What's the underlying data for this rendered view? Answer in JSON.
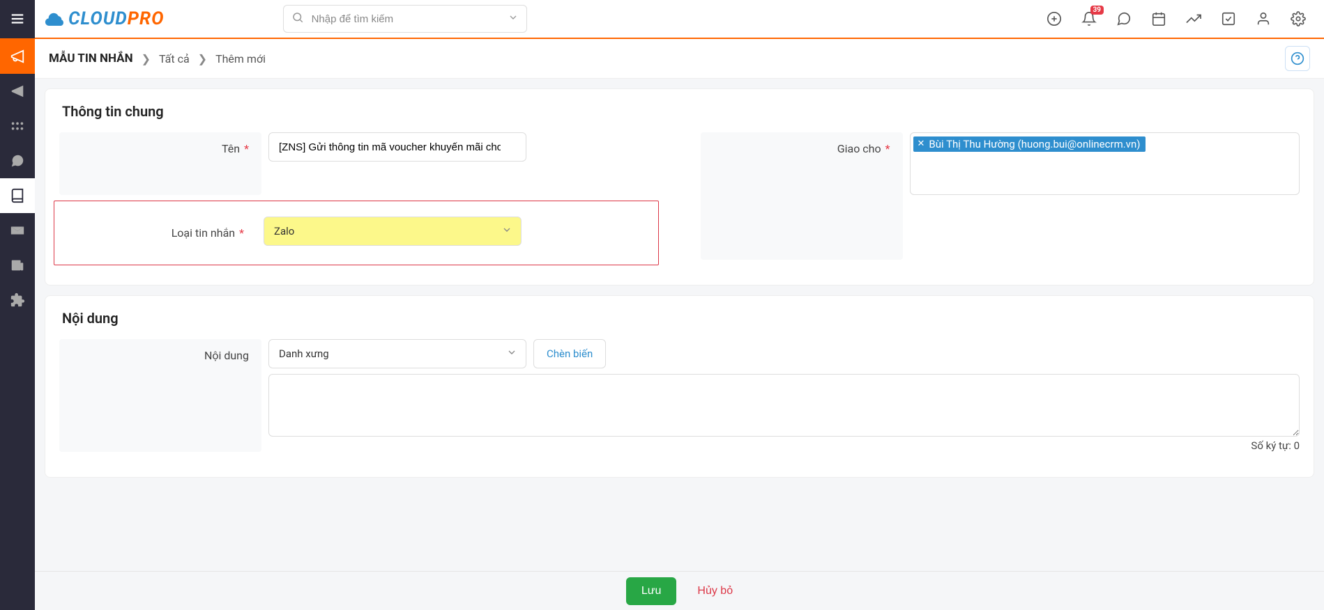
{
  "header": {
    "logo_cloud": "CLOUD",
    "logo_pro": "PRO",
    "search_placeholder": "Nhập để tìm kiếm",
    "notification_count": "39"
  },
  "breadcrumb": {
    "title": "MẪU TIN NHẮN",
    "item_all": "Tất cả",
    "item_new": "Thêm mới"
  },
  "section_general": {
    "title": "Thông tin chung",
    "name_label": "Tên",
    "name_value": "[ZNS] Gửi thông tin mã voucher khuyến mãi cho khách hàng",
    "assign_label": "Giao cho",
    "assign_tag": "Bùi Thị Thu Hường (huong.bui@onlinecrm.vn)",
    "type_label": "Loại tin nhắn",
    "type_value": "Zalo"
  },
  "section_content": {
    "title": "Nội dung",
    "content_label": "Nội dung",
    "salutation_value": "Danh xưng",
    "insert_var_label": "Chèn biến",
    "char_count_label": "Số ký tự: 0"
  },
  "footer": {
    "save": "Lưu",
    "cancel": "Hủy bỏ"
  }
}
